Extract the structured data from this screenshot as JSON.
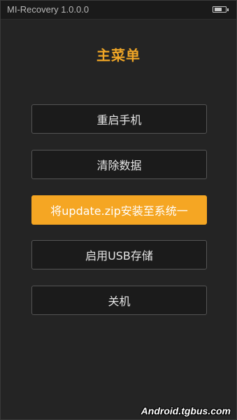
{
  "status_bar": {
    "title": "MI-Recovery 1.0.0.0",
    "battery_icon": "battery-icon"
  },
  "menu": {
    "title": "主菜单",
    "items": [
      {
        "label": "重启手机",
        "selected": false
      },
      {
        "label": "清除数据",
        "selected": false
      },
      {
        "label": "将update.zip安装至系统一",
        "selected": true
      },
      {
        "label": "启用USB存储",
        "selected": false
      },
      {
        "label": "关机",
        "selected": false
      }
    ]
  },
  "watermark": "Android.tgbus.com",
  "colors": {
    "accent": "#f5a623",
    "title": "#f0a626",
    "background": "#242424",
    "button_bg": "#1b1b1b",
    "button_border": "#545454"
  }
}
